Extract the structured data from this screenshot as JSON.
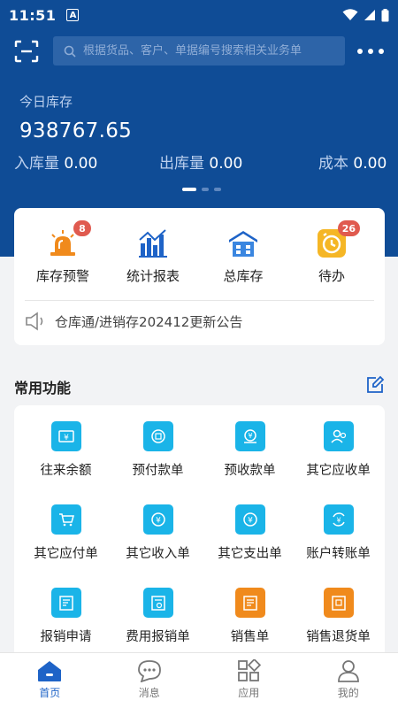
{
  "status_bar": {
    "time": "11:51",
    "notif_letter": "A"
  },
  "header": {
    "search_placeholder": "根据货品、客户、单据编号搜索相关业务单"
  },
  "summary": {
    "today_label": "今日库存",
    "today_value": "938767.65",
    "in_label": "入库量",
    "in_value": "0.00",
    "out_label": "出库量",
    "out_value": "0.00",
    "cost_label": "成本",
    "cost_value": "0.00"
  },
  "quick": [
    {
      "label": "库存预警",
      "badge": "8",
      "icon": "alarm-icon"
    },
    {
      "label": "统计报表",
      "icon": "bar-chart-icon"
    },
    {
      "label": "总库存",
      "icon": "warehouse-icon"
    },
    {
      "label": "待办",
      "badge": "26",
      "icon": "clock-icon"
    }
  ],
  "notice": {
    "text": "仓库通/进销存202412更新公告"
  },
  "common": {
    "title": "常用功能"
  },
  "functions": [
    {
      "label": "往来余额",
      "icon": "balance-icon",
      "color": "#1ab4e8"
    },
    {
      "label": "预付款单",
      "icon": "prepay-icon",
      "color": "#1ab4e8"
    },
    {
      "label": "预收款单",
      "icon": "prereceive-icon",
      "color": "#1ab4e8"
    },
    {
      "label": "其它应收单",
      "icon": "receivable-icon",
      "color": "#1ab4e8"
    },
    {
      "label": "其它应付单",
      "icon": "payable-icon",
      "color": "#1ab4e8"
    },
    {
      "label": "其它收入单",
      "icon": "income-icon",
      "color": "#1ab4e8"
    },
    {
      "label": "其它支出单",
      "icon": "expense-icon",
      "color": "#1ab4e8"
    },
    {
      "label": "账户转账单",
      "icon": "transfer-icon",
      "color": "#1ab4e8"
    },
    {
      "label": "报销申请",
      "icon": "reimburse-apply-icon",
      "color": "#1ab4e8"
    },
    {
      "label": "费用报销单",
      "icon": "reimburse-icon",
      "color": "#1ab4e8"
    },
    {
      "label": "销售单",
      "icon": "sales-icon",
      "color": "#f08a1c"
    },
    {
      "label": "销售退货单",
      "icon": "sales-return-icon",
      "color": "#f08a1c"
    }
  ],
  "tabs": [
    {
      "label": "首页",
      "icon": "home-icon"
    },
    {
      "label": "消息",
      "icon": "message-icon"
    },
    {
      "label": "应用",
      "icon": "apps-icon"
    },
    {
      "label": "我的",
      "icon": "profile-icon"
    }
  ],
  "colors": {
    "primary": "#0f4c96",
    "accent": "#1e63c7",
    "badge": "#e05a4f"
  }
}
